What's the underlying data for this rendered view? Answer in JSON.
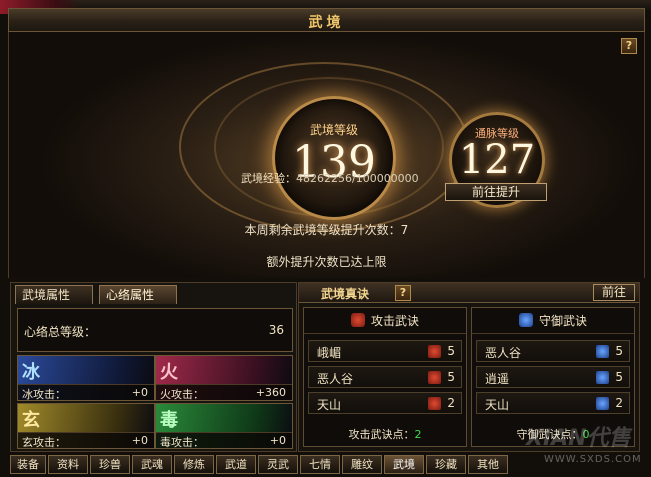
{
  "window": {
    "title": "武境",
    "help_label": "?",
    "close_label": "✕"
  },
  "hero": {
    "main_caption": "武境等级",
    "main_level": "139",
    "sub_caption": "通脉等级",
    "sub_level": "127",
    "exp_label": "武境经验：",
    "exp_value": "48262256/100000000",
    "goto_button": "前往提升",
    "weekly_text": "本周剩余武境等级提升次数：7",
    "extra_text": "额外提升次数已达上限"
  },
  "left_panel": {
    "tabs": [
      "武境属性",
      "心络属性"
    ],
    "active_tab": 1,
    "summary_label": "心络总等级：",
    "summary_value": "36",
    "elements": [
      {
        "glyph": "冰",
        "label": "冰攻击：",
        "value": "+0",
        "color": "#2b4a9a"
      },
      {
        "glyph": "火",
        "label": "火攻击：",
        "value": "+360",
        "color": "#a02a4a"
      },
      {
        "glyph": "玄",
        "label": "玄攻击：",
        "value": "+0",
        "color": "#a08a2a"
      },
      {
        "glyph": "毒",
        "label": "毒攻击：",
        "value": "+0",
        "color": "#2a8a3a"
      }
    ]
  },
  "right_panel": {
    "title": "武境真诀",
    "help_label": "?",
    "goto_button": "前往",
    "attack": {
      "header": "攻击武诀",
      "icon": "attack-emblem-icon",
      "items": [
        {
          "name": "峨嵋",
          "count": "5"
        },
        {
          "name": "恶人谷",
          "count": "5"
        },
        {
          "name": "天山",
          "count": "2"
        }
      ],
      "footer_label": "攻击武诀点：",
      "footer_value": "2"
    },
    "defense": {
      "header": "守御武诀",
      "icon": "defense-shield-icon",
      "items": [
        {
          "name": "恶人谷",
          "count": "5"
        },
        {
          "name": "逍遥",
          "count": "5"
        },
        {
          "name": "天山",
          "count": "2"
        }
      ],
      "footer_label": "守御武诀点：",
      "footer_value": "0"
    }
  },
  "bottom_tabs": [
    "装备",
    "资料",
    "珍兽",
    "武魂",
    "修炼",
    "武道",
    "灵武",
    "七情",
    "雕纹",
    "武境",
    "珍藏",
    "其他"
  ],
  "bottom_active": 9,
  "watermark": {
    "big": "XIAN代售",
    "small": "WWW.SXDS.COM"
  }
}
